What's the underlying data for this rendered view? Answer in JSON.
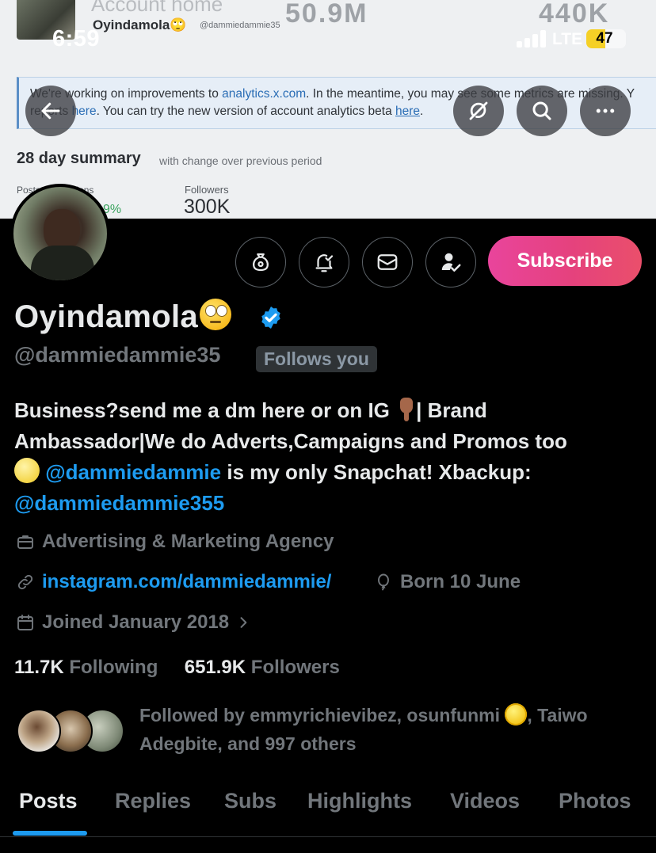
{
  "banner": {
    "ghost_title": "Account home",
    "ghost_num1": "50.9M",
    "ghost_num2": "440K",
    "mini_name": "Oyindamola🙄",
    "mini_handle": "@dammiedammie35",
    "notice_part1": "We're working on improvements to ",
    "notice_link": "analytics.x.com",
    "notice_part2": ". In the meantime, you may see some metrics are missing. Y",
    "notice_part3": "reports ",
    "notice_here1": "here",
    "notice_part4": ". You can try the new version of account analytics beta ",
    "notice_here2": "here",
    "notice_part5": ".",
    "summary_title": "28 day summary",
    "summary_sub": "with change over previous period",
    "posts_label": "Posts impressions",
    "posts_pct": "9%",
    "followers_label": "Followers",
    "followers_value": "300K"
  },
  "status_bar": {
    "time": "6:59",
    "network": "LTE",
    "battery": "47"
  },
  "nav": {
    "back_icon": "arrow-left-icon",
    "grok_icon": "grok-icon",
    "search_icon": "search-icon",
    "more_icon": "more-icon"
  },
  "profile": {
    "name": "Oyindamola",
    "handle": "@dammiedammie35",
    "follows_you": "Follows you",
    "subscribe_label": "Subscribe",
    "bio": {
      "line1_a": "Business?send me a dm here or on IG ",
      "line1_b": "| Brand Ambassador|We do Adverts,Campaigns and Promos too ",
      "mention1": "@dammiedammie",
      "line2": " is my only Snapchat! Xbackup: ",
      "mention2": "@dammiedammie355"
    },
    "category": "Advertising & Marketing Agency",
    "website": "instagram.com/dammiedammie/",
    "birthday": "Born 10 June",
    "joined": "Joined January 2018",
    "following_count": "11.7K",
    "following_label": "Following",
    "followers_count": "651.9K",
    "followers_label": "Followers",
    "followed_by_a": "Followed by emmyrichievibez, osunfunmi ",
    "followed_by_b": ", Taiwo Adegbite, and 997 others"
  },
  "tabs": [
    {
      "label": "Posts",
      "active": true
    },
    {
      "label": "Replies",
      "active": false
    },
    {
      "label": "Subs",
      "active": false
    },
    {
      "label": "Highlights",
      "active": false
    },
    {
      "label": "Videos",
      "active": false
    },
    {
      "label": "Photos",
      "active": false
    }
  ],
  "colors": {
    "accent": "#1d9bf0",
    "subscribe_gradient_start": "#e9449c",
    "subscribe_gradient_end": "#ea4f6b",
    "muted": "#71767b",
    "background": "#000000"
  }
}
